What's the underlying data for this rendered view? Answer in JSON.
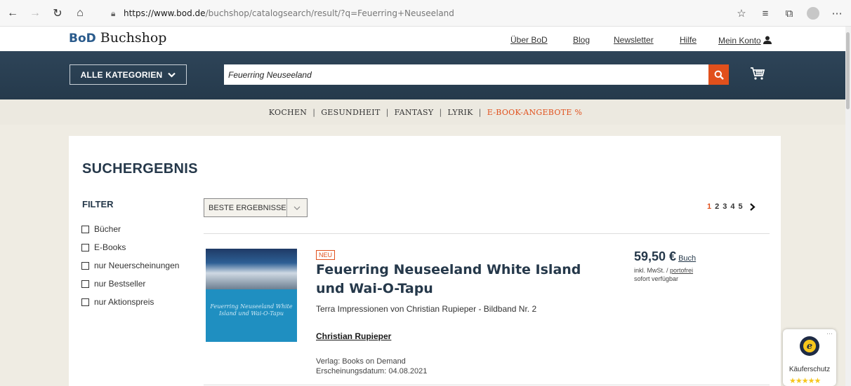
{
  "browser": {
    "url_host": "https://www.bod.de",
    "url_path": "/buchshop/catalogsearch/result/?q=Feuerring+Neuseeland"
  },
  "header": {
    "logo_bod": "BoD",
    "logo_text": "Buchshop",
    "links": [
      "Über BoD",
      "Blog",
      "Newsletter",
      "Hilfe",
      "Mein Konto"
    ]
  },
  "search": {
    "categories_label": "ALLE KATEGORIEN",
    "query": "Feuerring Neuseeland"
  },
  "catnav": {
    "items": [
      "KOCHEN",
      "GESUNDHEIT",
      "FANTASY",
      "LYRIK"
    ],
    "special": "E-BOOK-ANGEBOTE %",
    "separator": "|"
  },
  "results": {
    "heading": "SUCHERGEBNIS",
    "filter_heading": "FILTER",
    "filters": [
      "Bücher",
      "E-Books",
      "nur Neuerscheinungen",
      "nur Bestseller",
      "nur Aktionspreis"
    ],
    "sort_label": "BESTE ERGEBNISSE",
    "pages": [
      "1",
      "2",
      "3",
      "4",
      "5"
    ],
    "current_page": "1"
  },
  "book": {
    "badge": "NEU",
    "title": "Feuerring Neuseeland White Island und Wai-O-Tapu",
    "subtitle": "Terra Impressionen von Christian Rupieper - Bildband Nr. 2",
    "author": "Christian Rupieper",
    "publisher": "Verlag: Books on Demand",
    "release": "Erscheinungsdatum: 04.08.2021",
    "price": "59,50 €",
    "price_type": "Buch",
    "vat_prefix": "inkl. MwSt. /",
    "shipping": "portofrei",
    "availability": "sofort verfügbar",
    "cover_title": "Feuerring Neuseeland White Island und Wai-O-Tapu"
  },
  "trust": {
    "label": "Käuferschutz",
    "seal_letter": "e",
    "stars": "★★★★★"
  },
  "colors": {
    "accent": "#e1501c",
    "navy": "#25384a",
    "band": "#2e4458"
  }
}
